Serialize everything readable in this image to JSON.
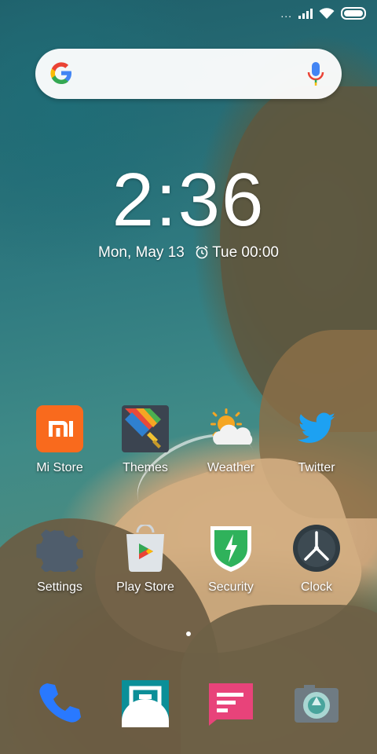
{
  "status_bar": {
    "signal_icon": "signal-icon",
    "wifi_icon": "wifi-icon",
    "battery_icon": "battery-icon",
    "dots_text": "..."
  },
  "search": {
    "logo": "google-logo-icon",
    "mic": "mic-icon"
  },
  "clock": {
    "time": "2:36",
    "date": "Mon, May 13",
    "alarm": "Tue 00:00"
  },
  "apps_row1": [
    {
      "label": "Mi Store",
      "icon": "mi-store-icon"
    },
    {
      "label": "Themes",
      "icon": "themes-icon"
    },
    {
      "label": "Weather",
      "icon": "weather-icon"
    },
    {
      "label": "Twitter",
      "icon": "twitter-icon"
    }
  ],
  "apps_row2": [
    {
      "label": "Settings",
      "icon": "settings-icon"
    },
    {
      "label": "Play Store",
      "icon": "play-store-icon"
    },
    {
      "label": "Security",
      "icon": "security-icon"
    },
    {
      "label": "Clock",
      "icon": "clock-icon"
    }
  ],
  "dock": [
    {
      "icon": "phone-icon"
    },
    {
      "icon": "maxthon-browser-icon"
    },
    {
      "icon": "messaging-icon"
    },
    {
      "icon": "camera-icon"
    }
  ],
  "colors": {
    "mi_orange": "#f96a1d",
    "security_green": "#2fb25b",
    "twitter_blue": "#1da1f2"
  }
}
